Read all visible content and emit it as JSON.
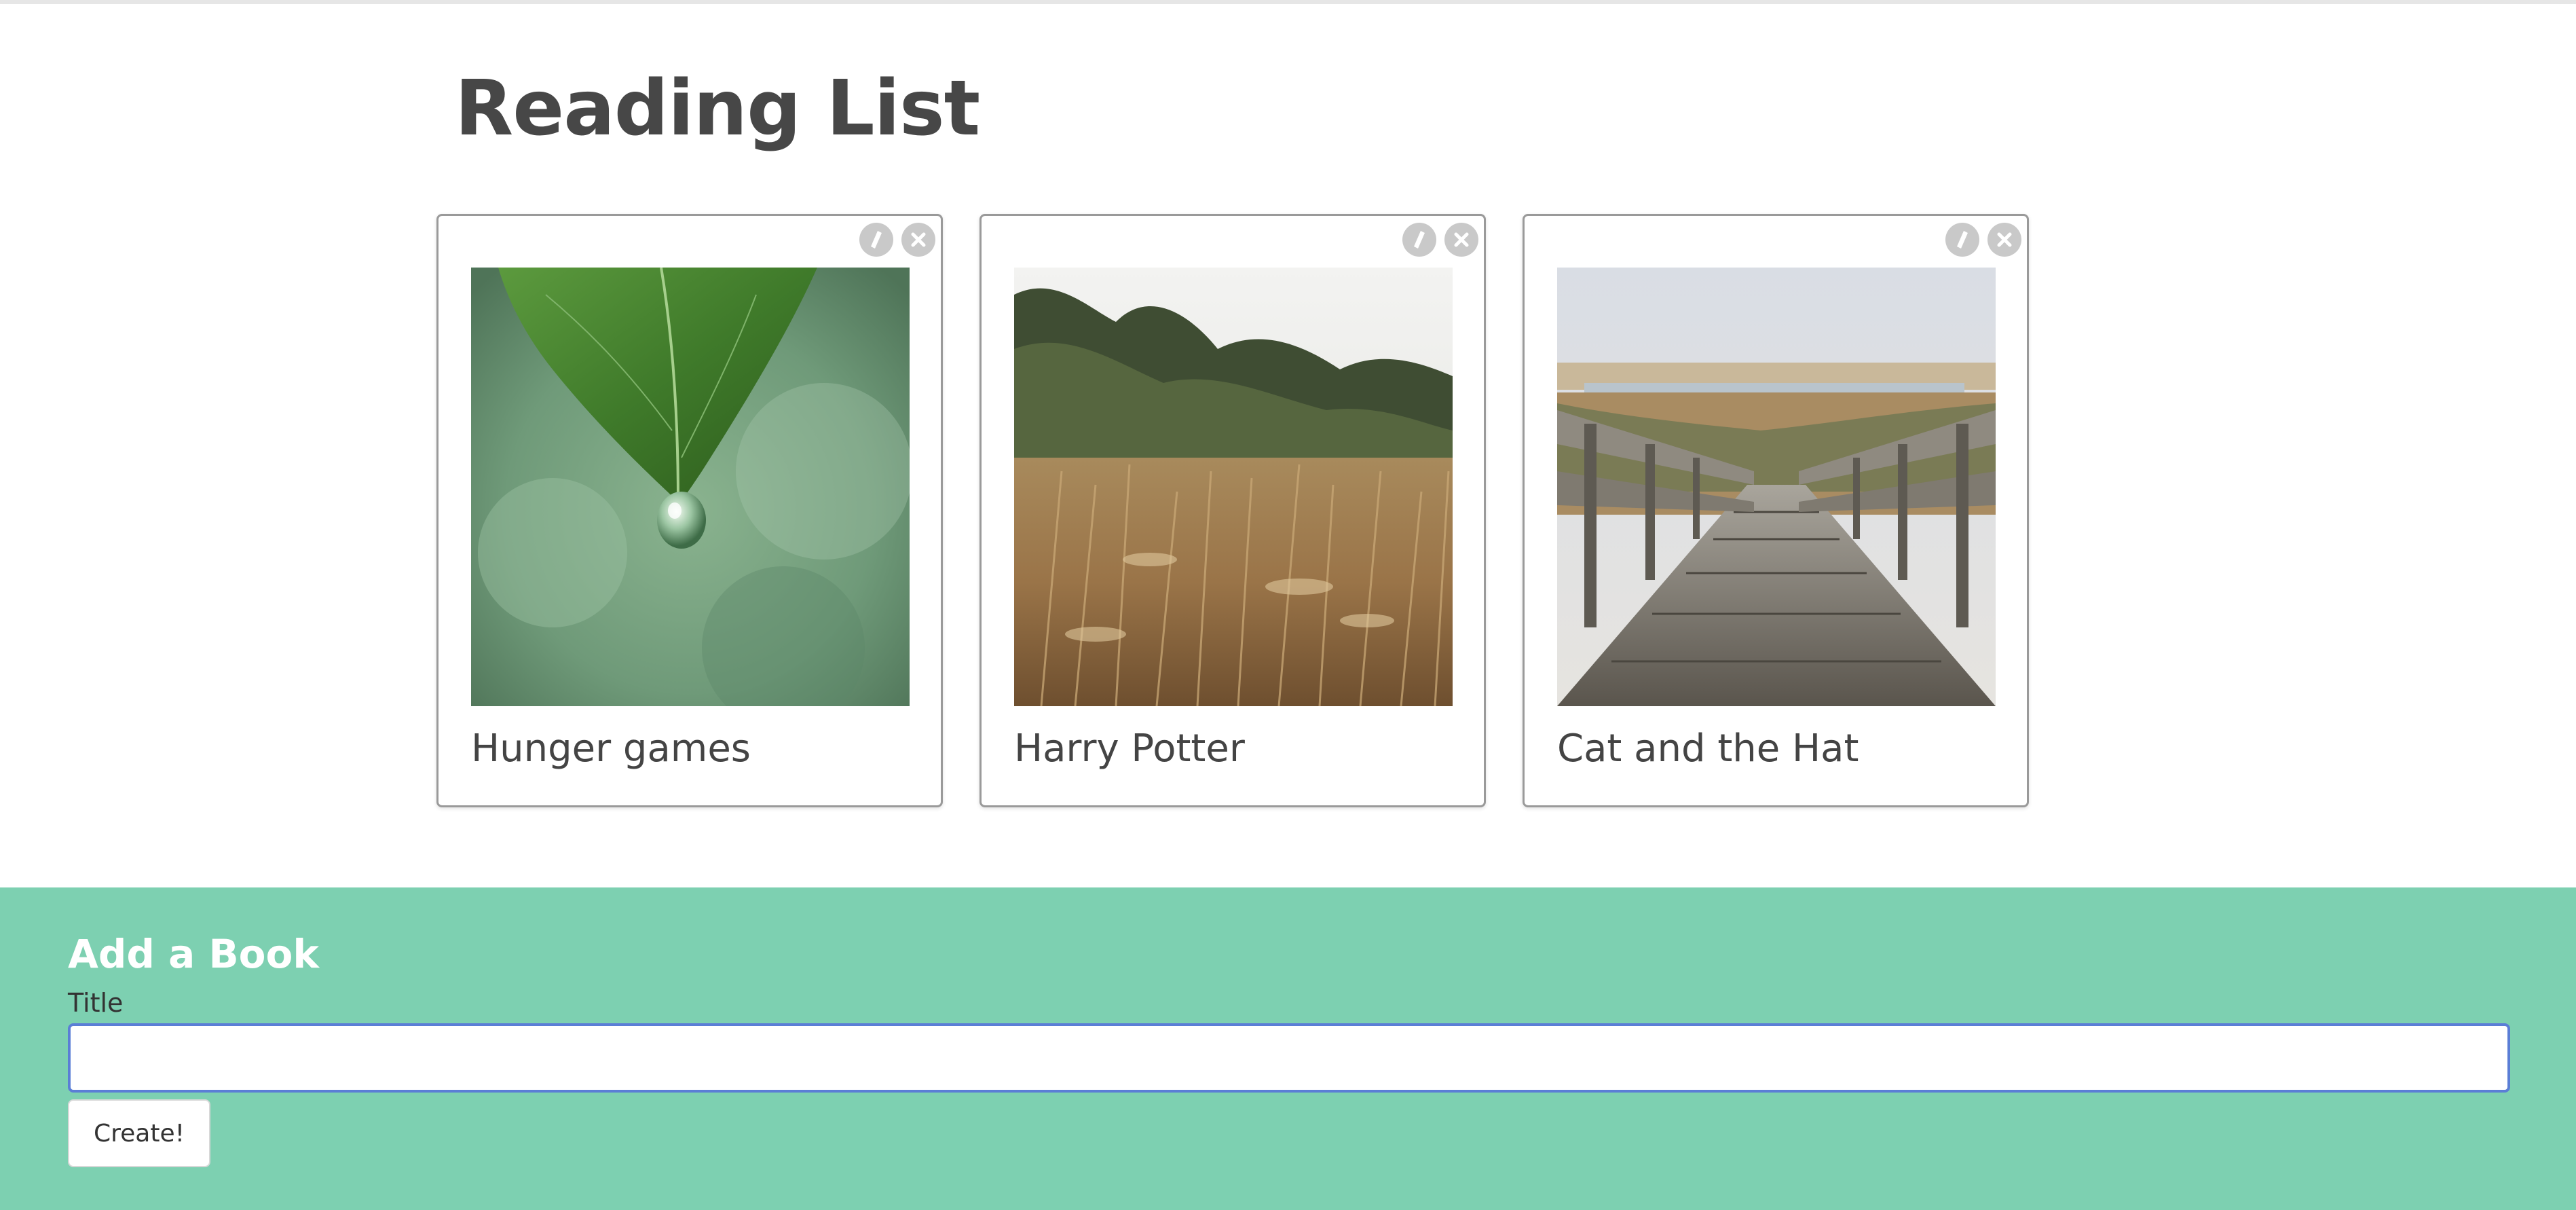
{
  "page": {
    "title": "Reading List"
  },
  "books": [
    {
      "title": "Hunger games",
      "image": "leaf-water-drop-photo"
    },
    {
      "title": "Harry Potter",
      "image": "dry-grass-field-photo"
    },
    {
      "title": "Cat and the Hat",
      "image": "wooden-boardwalk-photo"
    }
  ],
  "card_actions": {
    "edit_icon": "pencil-icon",
    "delete_icon": "close-icon"
  },
  "add_form": {
    "heading": "Add a Book",
    "title_label": "Title",
    "title_value": "",
    "create_label": "Create!"
  },
  "colors": {
    "form_background": "#7dd0b1",
    "input_focus_border": "#5b7ed6",
    "action_button": "#c9c9c9"
  }
}
